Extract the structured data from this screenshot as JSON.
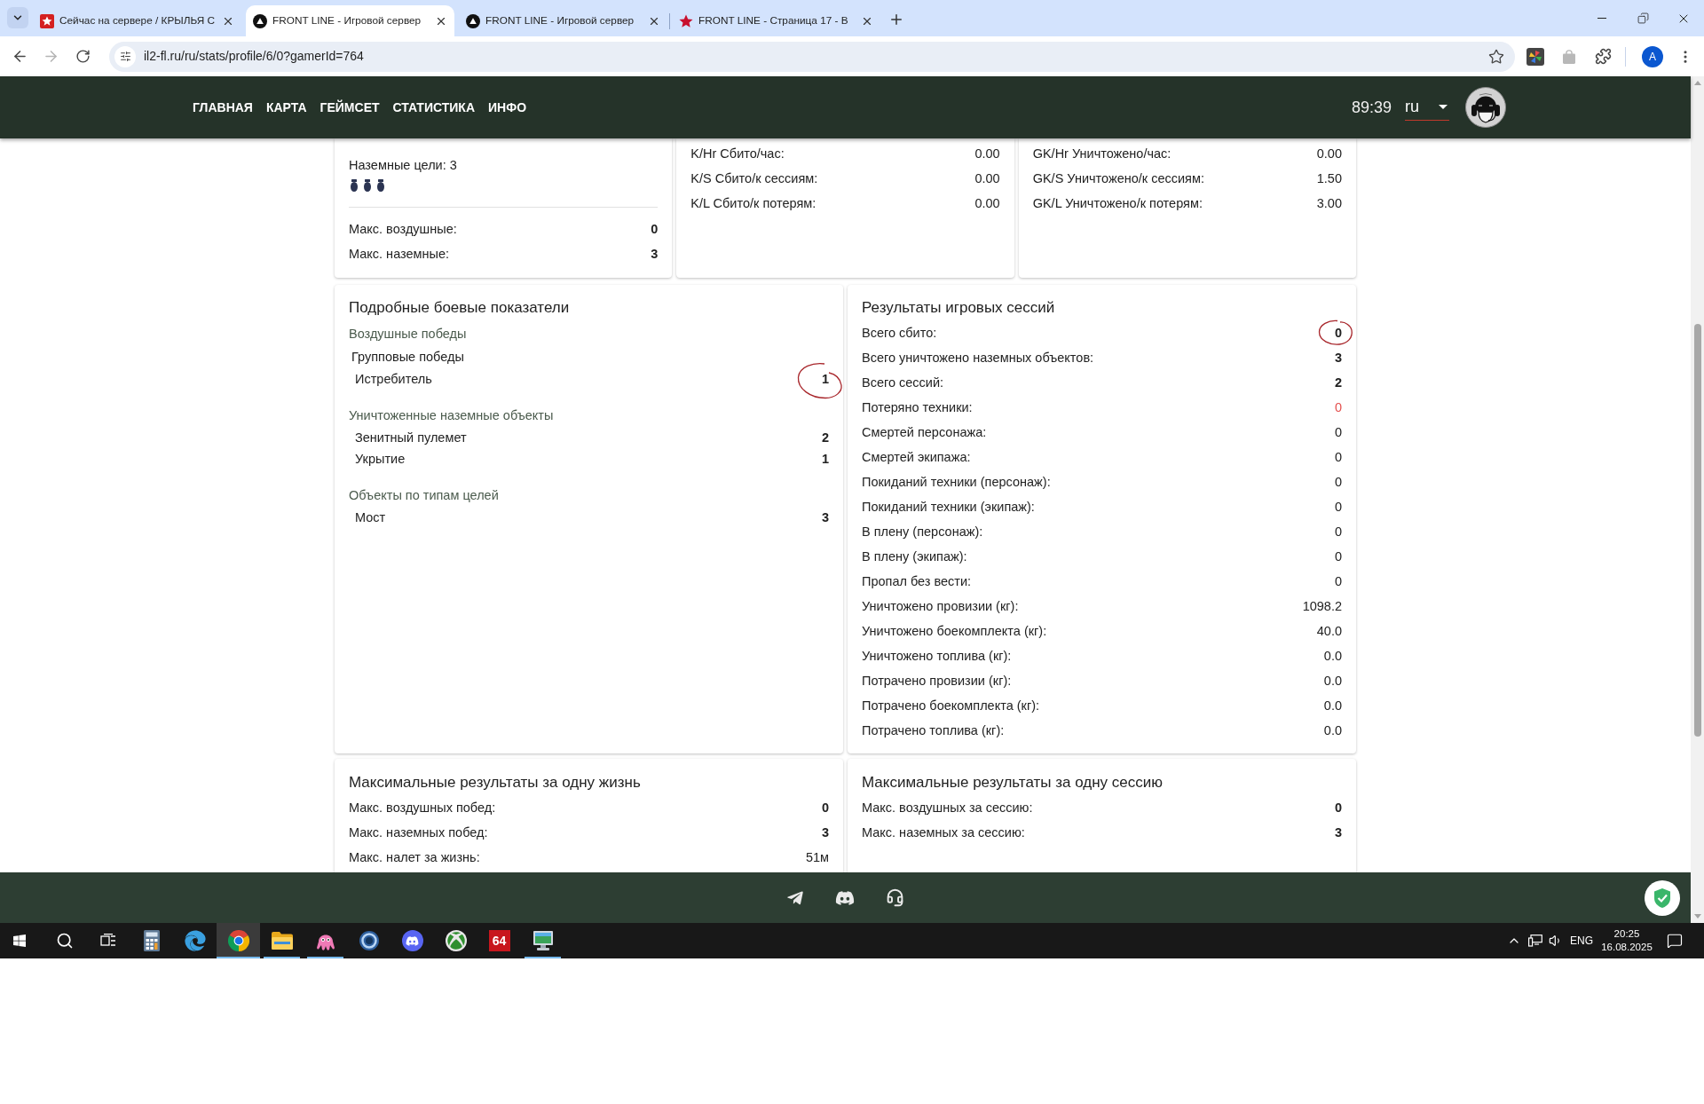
{
  "browser": {
    "tabs": [
      {
        "kind": "star-square",
        "title": "Сейчас на сервере / КРЫЛЬЯ С",
        "selected": false
      },
      {
        "kind": "triangle-circle",
        "title": "FRONT LINE - Игровой сервер",
        "selected": true
      },
      {
        "kind": "triangle-circle",
        "title": "FRONT LINE - Игровой сервер",
        "selected": false
      },
      {
        "kind": "star",
        "title": "FRONT LINE - Страница 17 - В",
        "selected": false
      }
    ],
    "forward_disabled": true,
    "url": "il2-fl.ru/ru/stats/profile/6/0?gamerId=764",
    "profile_initial": "A"
  },
  "site_header": {
    "nav": [
      "ГЛАВНАЯ",
      "КАРТА",
      "ГЕЙМСЕТ",
      "СТАТИСТИКА",
      "ИНФО"
    ],
    "timer": "89:39",
    "language": "ru"
  },
  "summary_cards": [
    {
      "heading": "Наземные цели: 3",
      "markers": [
        {
          "kind": "bomb"
        },
        {
          "kind": "bomb"
        },
        {
          "kind": "bomb"
        }
      ],
      "rows": [
        {
          "label": "Макс. воздушные:",
          "value": "0",
          "kind": "bold"
        },
        {
          "label": "Макс. наземные:",
          "value": "3",
          "kind": "bold"
        }
      ]
    },
    {
      "rows": [
        {
          "label": "K/Hr Сбито/час:",
          "value": "0.00",
          "kind": "plain"
        },
        {
          "label": "K/S Сбито/к сессиям:",
          "value": "0.00",
          "kind": "plain"
        },
        {
          "label": "K/L Сбито/к потерям:",
          "value": "0.00",
          "kind": "plain"
        }
      ]
    },
    {
      "rows": [
        {
          "label": "GK/Hr Уничтожено/час:",
          "value": "0.00",
          "kind": "plain"
        },
        {
          "label": "GK/S Уничтожено/к сессиям:",
          "value": "1.50",
          "kind": "plain"
        },
        {
          "label": "GK/L Уничтожено/к потерям:",
          "value": "3.00",
          "kind": "plain"
        }
      ]
    }
  ],
  "combat_details": {
    "title": "Подробные боевые показатели",
    "sections": [
      {
        "label": "Воздушные победы",
        "children": [
          {
            "label": "Групповые победы",
            "children": [
              {
                "label": "Истребитель",
                "value": "1",
                "kind": "bold",
                "circled": true
              }
            ]
          }
        ]
      },
      {
        "label": "Уничтоженные наземные объекты",
        "children": [
          {
            "label": "Зенитный пулемет",
            "value": "2",
            "kind": "bold",
            "circled": false
          },
          {
            "label": "Укрытие",
            "value": "1",
            "kind": "bold",
            "circled": false
          }
        ]
      },
      {
        "label": "Объекты по типам целей",
        "children": [
          {
            "label": "Мост",
            "value": "3",
            "kind": "bold",
            "circled": false
          }
        ]
      }
    ]
  },
  "session_results": {
    "title": "Результаты игровых сессий",
    "rows": [
      {
        "label": "Всего сбито:",
        "value": "0",
        "kind": "bold",
        "circled": true
      },
      {
        "label": "Всего уничтожено наземных объектов:",
        "value": "3",
        "kind": "bold",
        "circled": false
      },
      {
        "label": "Всего сессий:",
        "value": "2",
        "kind": "bold",
        "circled": false
      },
      {
        "label": "Потеряно техники:",
        "value": "0",
        "kind": "alert",
        "circled": false
      },
      {
        "label": "Смертей персонажа:",
        "value": "0",
        "kind": "plain",
        "circled": false
      },
      {
        "label": "Смертей экипажа:",
        "value": "0",
        "kind": "plain",
        "circled": false
      },
      {
        "label": "Покиданий техники (персонаж):",
        "value": "0",
        "kind": "plain",
        "circled": false
      },
      {
        "label": "Покиданий техники (экипаж):",
        "value": "0",
        "kind": "plain",
        "circled": false
      },
      {
        "label": "В плену (персонаж):",
        "value": "0",
        "kind": "plain",
        "circled": false
      },
      {
        "label": "В плену (экипаж):",
        "value": "0",
        "kind": "plain",
        "circled": false
      },
      {
        "label": "Пропал без вести:",
        "value": "0",
        "kind": "plain",
        "circled": false
      },
      {
        "label": "Уничтожено провизии (кг):",
        "value": "1098.2",
        "kind": "plain",
        "circled": false
      },
      {
        "label": "Уничтожено боекомплекта (кг):",
        "value": "40.0",
        "kind": "plain",
        "circled": false
      },
      {
        "label": "Уничтожено топлива (кг):",
        "value": "0.0",
        "kind": "plain",
        "circled": false
      },
      {
        "label": "Потрачено провизии (кг):",
        "value": "0.0",
        "kind": "plain",
        "circled": false
      },
      {
        "label": "Потрачено боекомплекта (кг):",
        "value": "0.0",
        "kind": "plain",
        "circled": false
      },
      {
        "label": "Потрачено топлива (кг):",
        "value": "0.0",
        "kind": "plain",
        "circled": false
      }
    ]
  },
  "max_per_life": {
    "title": "Максимальные результаты за одну жизнь",
    "rows": [
      {
        "label": "Макс. воздушных побед:",
        "value": "0",
        "kind": "bold"
      },
      {
        "label": "Макс. наземных побед:",
        "value": "3",
        "kind": "bold"
      },
      {
        "label": "Макс. налет за жизнь:",
        "value": "51м",
        "kind": "plain"
      }
    ]
  },
  "max_per_session": {
    "title": "Максимальные результаты за одну сессию",
    "rows": [
      {
        "label": "Макс. воздушных за сессию:",
        "value": "0",
        "kind": "bold"
      },
      {
        "label": "Макс. наземных за сессию:",
        "value": "3",
        "kind": "bold"
      }
    ]
  },
  "taskbar": {
    "apps": [
      {
        "kind": "calculator",
        "running": false,
        "selected": false
      },
      {
        "kind": "edge",
        "running": false,
        "selected": false
      },
      {
        "kind": "chrome",
        "running": true,
        "selected": true
      },
      {
        "kind": "explorer",
        "running": true,
        "selected": false
      },
      {
        "kind": "octopus",
        "running": true,
        "selected": false
      },
      {
        "kind": "ring",
        "running": false,
        "selected": false
      },
      {
        "kind": "discord",
        "running": false,
        "selected": false
      },
      {
        "kind": "xbox",
        "running": false,
        "selected": false
      },
      {
        "kind": "tile",
        "label": "64",
        "running": false,
        "selected": false
      },
      {
        "kind": "monitor",
        "running": true,
        "selected": false
      }
    ],
    "language": "ENG",
    "time": "20:25",
    "date": "16.08.2025"
  }
}
